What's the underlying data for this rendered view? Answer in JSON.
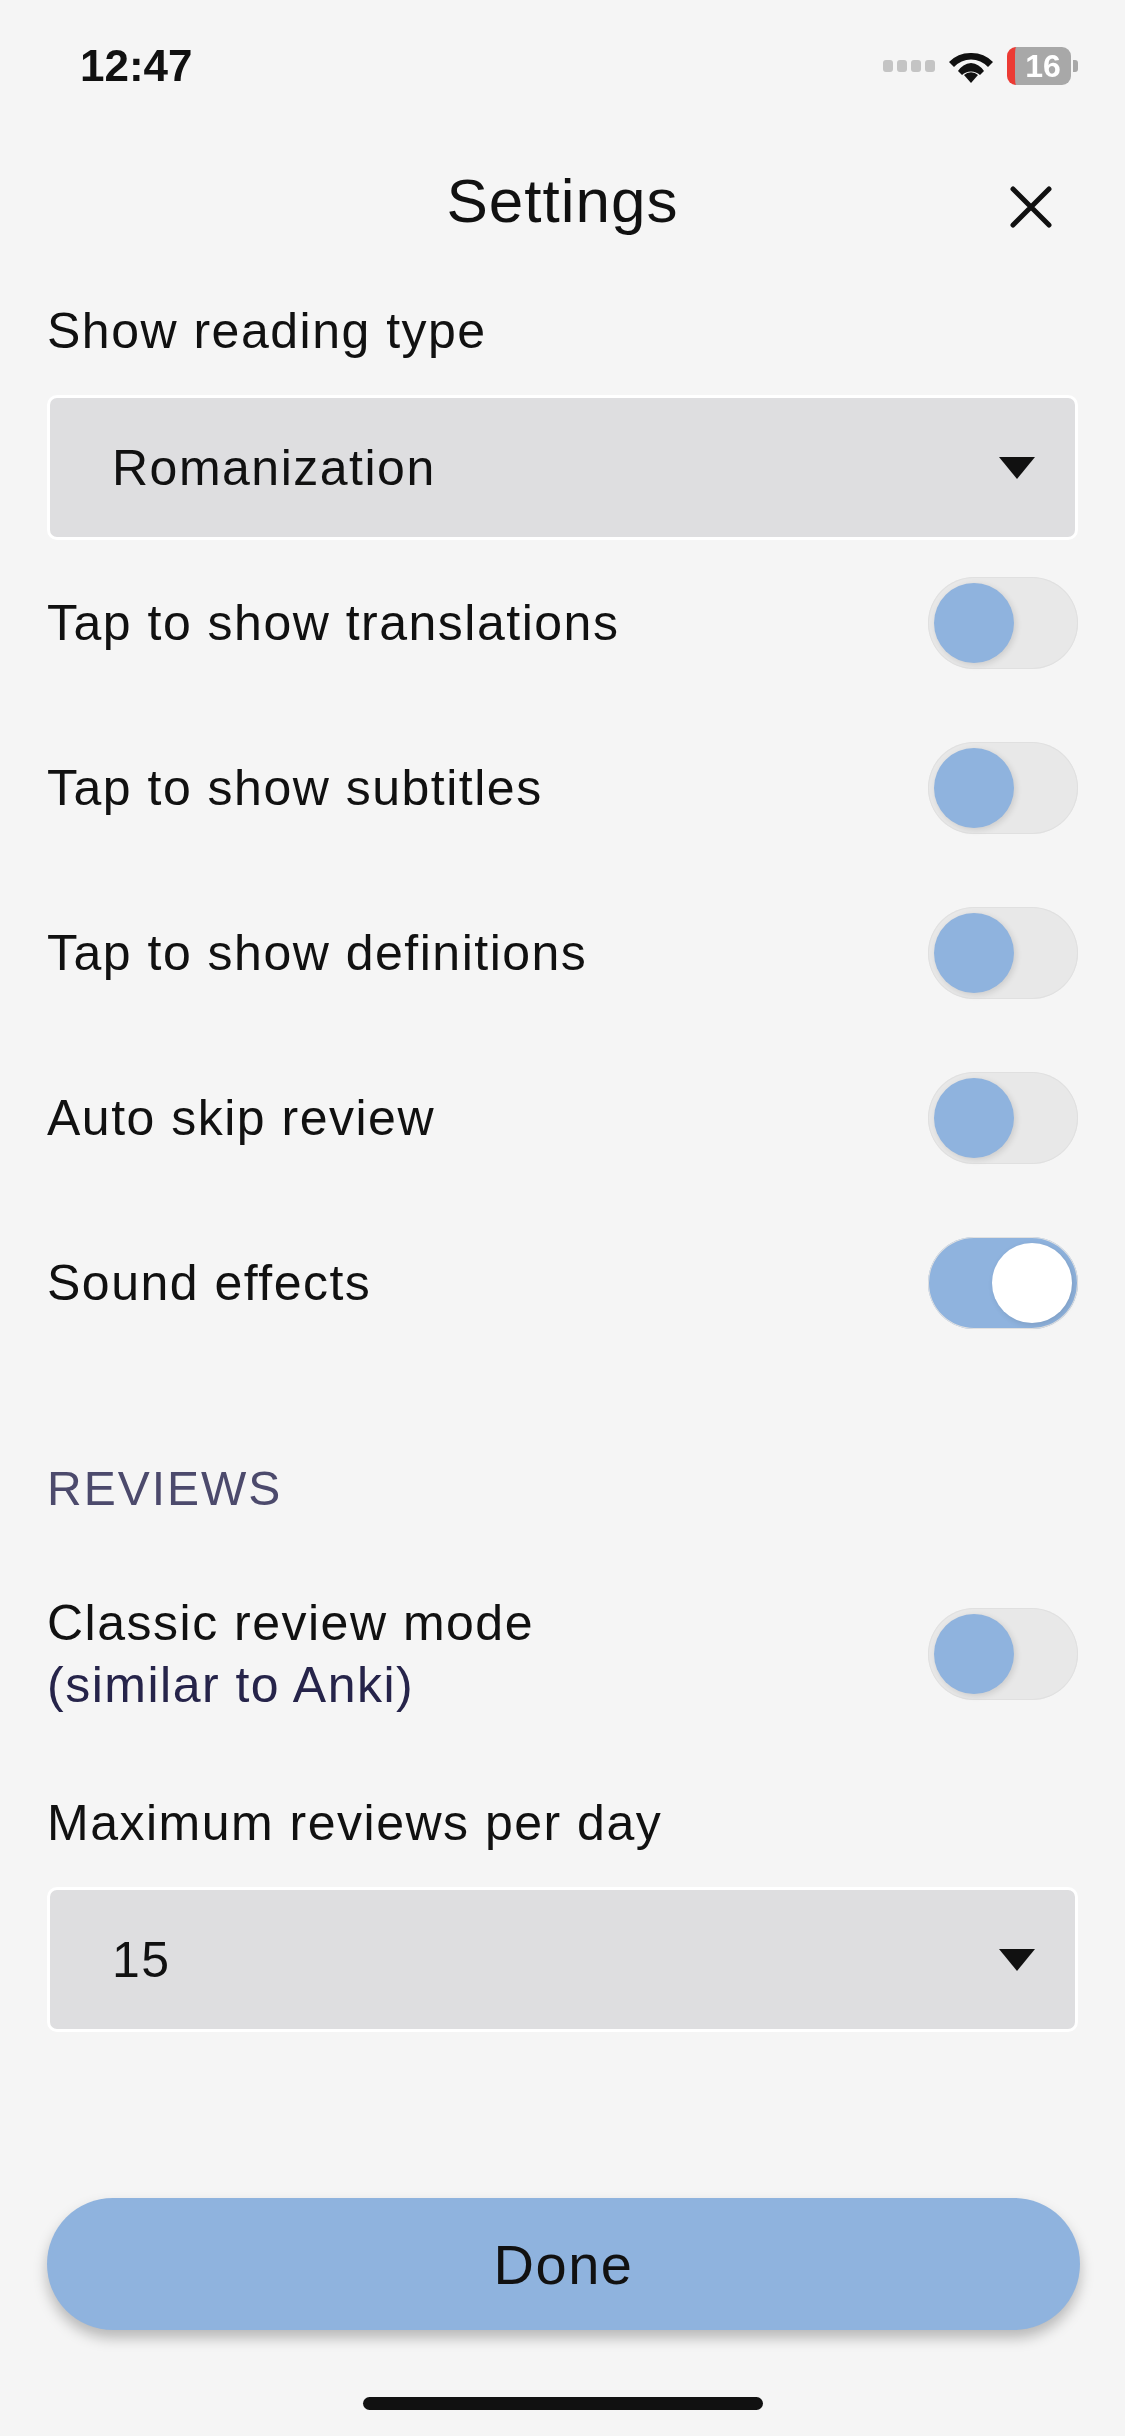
{
  "status_bar": {
    "time": "12:47",
    "battery": "16"
  },
  "header": {
    "title": "Settings"
  },
  "sections": [
    {
      "items": [
        {
          "kind": "select",
          "label": "Show reading type",
          "value": "Romanization"
        },
        {
          "kind": "toggle",
          "label": "Tap to show translations",
          "on": false
        },
        {
          "kind": "toggle",
          "label": "Tap to show subtitles",
          "on": false
        },
        {
          "kind": "toggle",
          "label": "Tap to show definitions",
          "on": false
        },
        {
          "kind": "toggle",
          "label": "Auto skip review",
          "on": false
        },
        {
          "kind": "toggle",
          "label": "Sound effects",
          "on": true
        }
      ]
    },
    {
      "title": "REVIEWS",
      "items": [
        {
          "kind": "toggle",
          "label": "Classic review mode",
          "sublabel": "(similar to Anki)",
          "on": false
        },
        {
          "kind": "select",
          "label": "Maximum reviews per day",
          "value": "15"
        }
      ]
    }
  ],
  "done_button": "Done"
}
